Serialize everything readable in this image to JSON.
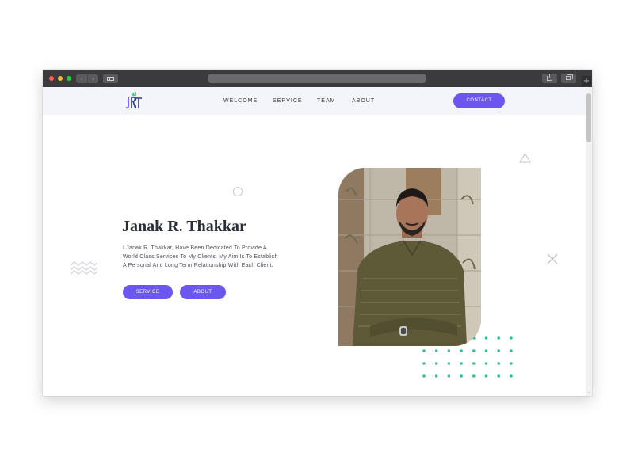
{
  "browser": {
    "back_glyph": "‹",
    "forward_glyph": "›",
    "new_tab_glyph": "+",
    "scroll_down_glyph": "⌄"
  },
  "site": {
    "logo_text": "JRT",
    "nav": [
      "WELCOME",
      "SERVICE",
      "TEAM",
      "ABOUT"
    ],
    "contact_label": "CONTACT",
    "accent_color": "#6c56f0",
    "dot_color": "#2fc2a0"
  },
  "hero": {
    "title": "Janak R. Thakkar",
    "description": "I Janak R. Thakkar, Have Been Dedicated To Provide A World Class Services To My Clients. My Aim Is To Establish A Personal And Long Term Relationship With Each Client.",
    "service_button": "SERVICE",
    "about_button": "ABOUT"
  }
}
